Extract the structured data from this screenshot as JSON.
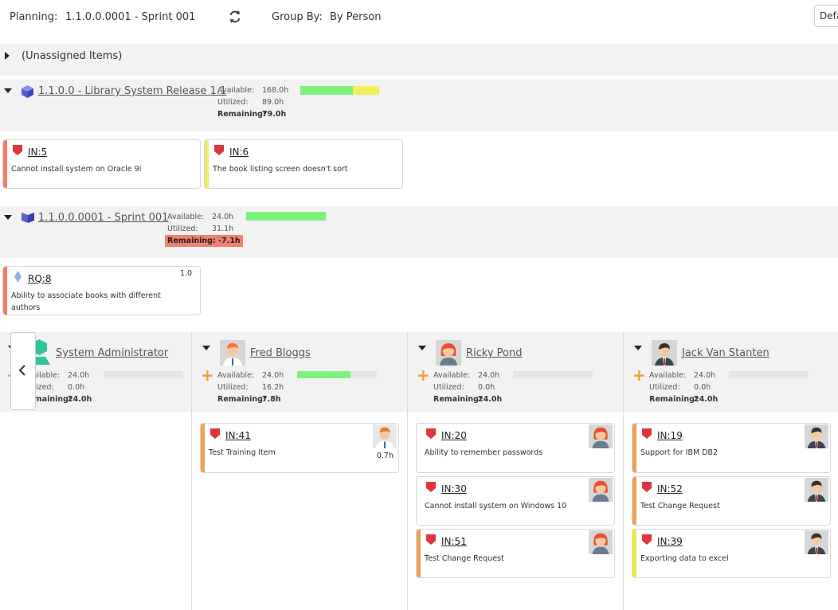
{
  "header": {
    "planning_label": "Planning:",
    "planning_value": "1.1.0.0.0001 - Sprint 001",
    "groupby_label": "Group By:",
    "groupby_value": "By Person",
    "default_button": "Default"
  },
  "unassigned": {
    "label": "(Unassigned Items)"
  },
  "release": {
    "name": "1.1.0.0 - Library System Release 1.1",
    "available_label": "Available:",
    "available": "168.0h",
    "utilized_label": "Utilized:",
    "utilized": "89.0h",
    "remaining_label": "Remaining:",
    "remaining": "79.0h",
    "progress": {
      "green": 0.67,
      "yellow": 0.33
    },
    "cards": [
      {
        "id": "IN:5",
        "title": "Cannot install system on Oracle 9i",
        "stripe": "#f0806a"
      },
      {
        "id": "IN:6",
        "title": "The book listing screen doesn't sort",
        "stripe": "#eded62"
      }
    ]
  },
  "sprint": {
    "name": "1.1.0.0.0001 - Sprint 001",
    "available_label": "Available:",
    "available": "24.0h",
    "utilized_label": "Utilized:",
    "utilized": "31.1h",
    "remaining_label": "Remaining:",
    "remaining": "-7.1h",
    "progress": {
      "green": 1.0
    },
    "cards": [
      {
        "id": "RQ:8",
        "title": "Ability to associate books with different authors",
        "estimate": "1.0",
        "stripe": "#f0806a"
      }
    ]
  },
  "people": [
    {
      "name": "System Administrator",
      "available_label": "Available:",
      "available": "24.0h",
      "utilized_label": "Utilized:",
      "utilized": "0.0h",
      "remaining_label": "Remaining:",
      "remaining": "24.0h",
      "progress": 0.0,
      "cards": []
    },
    {
      "name": "Fred Bloggs",
      "available_label": "Available:",
      "available": "24.0h",
      "utilized_label": "Utilized:",
      "utilized": "16.2h",
      "remaining_label": "Remaining:",
      "remaining": "7.8h",
      "progress": 0.67,
      "cards": [
        {
          "id": "IN:41",
          "title": "Test Training Item",
          "hours": "0.7h",
          "stripe": "#f0a05a",
          "avatar": "man-orange-hair"
        }
      ]
    },
    {
      "name": "Ricky Pond",
      "available_label": "Available:",
      "available": "24.0h",
      "utilized_label": "Utilized:",
      "utilized": "0.0h",
      "remaining_label": "Remaining:",
      "remaining": "24.0h",
      "progress": 0.0,
      "cards": [
        {
          "id": "IN:20",
          "title": "Ability to remember passwords",
          "stripe": null,
          "avatar": "woman-red-hair"
        },
        {
          "id": "IN:30",
          "title": "Cannot install system on Windows 10",
          "stripe": null,
          "avatar": "woman-red-hair"
        },
        {
          "id": "IN:51",
          "title": "Test Change Request",
          "stripe": "#f0a05a",
          "avatar": "woman-red-hair"
        }
      ]
    },
    {
      "name": "Jack Van Stanten",
      "available_label": "Available:",
      "available": "24.0h",
      "utilized_label": "Utilized:",
      "utilized": "0.0h",
      "remaining_label": "Remaining:",
      "remaining": "24.0h",
      "progress": 0.0,
      "cards": [
        {
          "id": "IN:19",
          "title": "Support for IBM DB2",
          "stripe": "#f0a05a",
          "avatar": "man-suit"
        },
        {
          "id": "IN:52",
          "title": "Test Change Request",
          "stripe": "#f0a05a",
          "avatar": "man-suit"
        },
        {
          "id": "IN:39",
          "title": "Exporting data to excel",
          "stripe": "#eded40",
          "avatar": "man-suit"
        }
      ]
    }
  ],
  "colors": {
    "green": "#7ef07e",
    "yellow": "#f0f060",
    "bar_bg": "#e5e5e5",
    "negative": "#f08070",
    "flag": "#e0353f",
    "accent_orange": "#f39c32"
  }
}
